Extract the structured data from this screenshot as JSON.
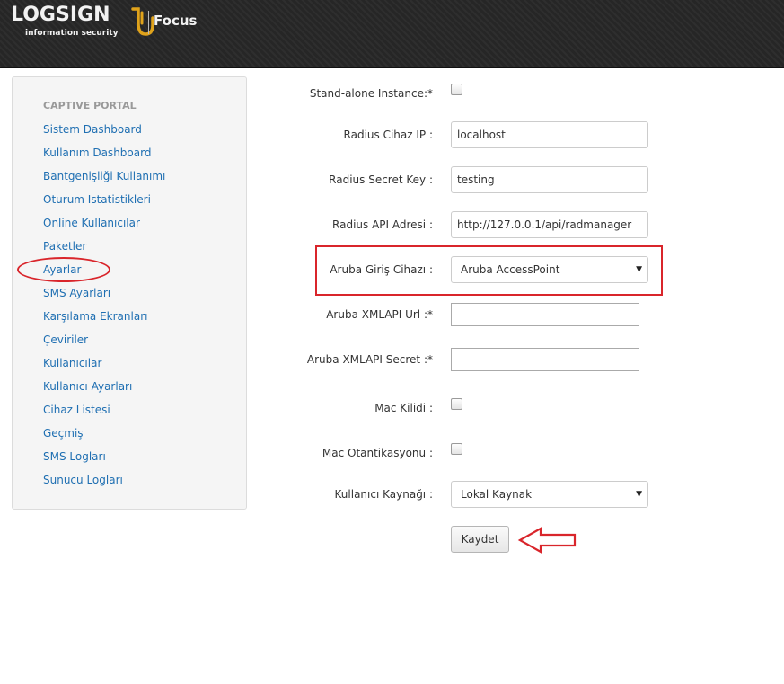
{
  "header": {
    "logo_text": "LOGSIGN",
    "logo_tagline": "information security",
    "product_name": "Focus"
  },
  "sidebar": {
    "heading": "CAPTIVE PORTAL",
    "items": [
      {
        "label": "Sistem Dashboard"
      },
      {
        "label": "Kullanım Dashboard"
      },
      {
        "label": "Bantgenişliği Kullanımı"
      },
      {
        "label": "Oturum Istatistikleri"
      },
      {
        "label": "Online Kullanıcılar"
      },
      {
        "label": "Paketler"
      },
      {
        "label": "Ayarlar"
      },
      {
        "label": "SMS Ayarları"
      },
      {
        "label": "Karşılama Ekranları"
      },
      {
        "label": "Çeviriler"
      },
      {
        "label": "Kullanıcılar"
      },
      {
        "label": "Kullanıcı Ayarları"
      },
      {
        "label": "Cihaz Listesi"
      },
      {
        "label": "Geçmiş"
      },
      {
        "label": "SMS Logları"
      },
      {
        "label": "Sunucu Logları"
      }
    ]
  },
  "form": {
    "standalone_label": "Stand-alone Instance:*",
    "standalone_checked": false,
    "radius_ip_label": "Radius Cihaz IP :",
    "radius_ip_value": "localhost",
    "radius_secret_label": "Radius Secret Key :",
    "radius_secret_value": "testing",
    "radius_api_label": "Radius API Adresi :",
    "radius_api_value": "http://127.0.0.1/api/radmanager",
    "aruba_device_label": "Aruba Giriş Cihazı :",
    "aruba_device_value": "Aruba AccessPoint",
    "xmlapi_url_label": "Aruba XMLAPI Url :*",
    "xmlapi_url_value": "",
    "xmlapi_secret_label": "Aruba XMLAPI Secret :*",
    "xmlapi_secret_value": "",
    "mac_lock_label": "Mac Kilidi :",
    "mac_lock_checked": false,
    "mac_auth_label": "Mac Otantikasyonu :",
    "mac_auth_checked": false,
    "user_source_label": "Kullanıcı Kaynağı :",
    "user_source_value": "Lokal Kaynak",
    "save_label": "Kaydet"
  },
  "colors": {
    "header_bg": "#262626",
    "link": "#1f6fb2",
    "annotation_red": "#d9252b",
    "logo_accent": "#e0a31b"
  }
}
